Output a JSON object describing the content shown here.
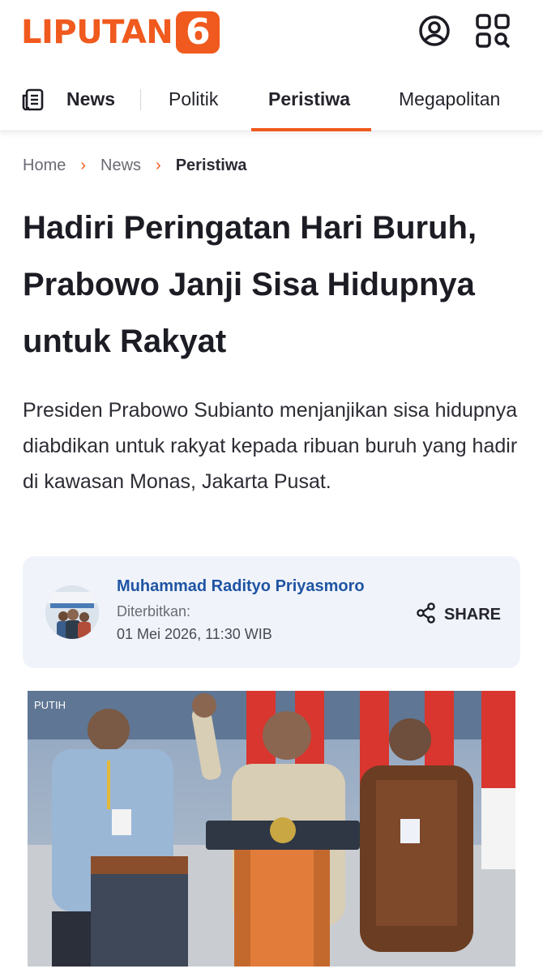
{
  "header": {
    "logo_text": "LIPUTAN",
    "logo_number": "6",
    "user_icon": "user-circle-icon",
    "menu_icon": "grid-search-icon",
    "brand_color": "#f05a1e"
  },
  "nav": {
    "icon": "newspaper-icon",
    "items": [
      {
        "label": "News"
      },
      {
        "label": "Politik"
      },
      {
        "label": "Peristiwa",
        "active": true
      },
      {
        "label": "Megapolitan"
      }
    ]
  },
  "breadcrumb": {
    "items": [
      "Home",
      "News",
      "Peristiwa"
    ],
    "separator_icon": "chevron-right-icon"
  },
  "article": {
    "title": "Hadiri Peringatan Hari Buruh, Prabowo Janji Sisa Hidupnya untuk Rakyat",
    "lede": "Presiden Prabowo Subianto menjanjikan sisa hidupnya diabdikan untuk rakyat kepada ribuan buruh yang hadir di kawasan Monas, Jakarta Pusat.",
    "author": "Muhammad Radityo Priyasmoro",
    "published_label": "Diterbitkan:",
    "published_date": "01 Mei 2026, 11:30 WIB",
    "share_label": "SHARE",
    "share_icon": "share-icon",
    "photo_watermark": "PUTIH"
  }
}
